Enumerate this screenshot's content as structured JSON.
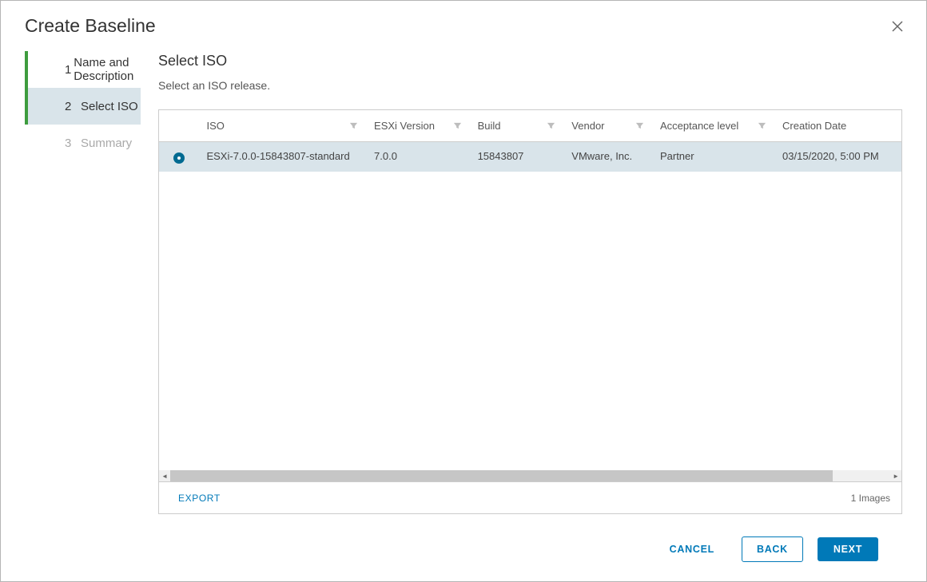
{
  "dialog": {
    "title": "Create Baseline"
  },
  "steps": [
    {
      "num": "1",
      "label": "Name and Description",
      "state": "completed"
    },
    {
      "num": "2",
      "label": "Select ISO",
      "state": "active"
    },
    {
      "num": "3",
      "label": "Summary",
      "state": "pending"
    }
  ],
  "panel": {
    "title": "Select ISO",
    "subtitle": "Select an ISO release."
  },
  "table": {
    "columns": [
      {
        "key": "iso",
        "label": "ISO"
      },
      {
        "key": "ver",
        "label": "ESXi Version"
      },
      {
        "key": "build",
        "label": "Build"
      },
      {
        "key": "vendor",
        "label": "Vendor"
      },
      {
        "key": "accept",
        "label": "Acceptance level"
      },
      {
        "key": "date",
        "label": "Creation Date"
      }
    ],
    "rows": [
      {
        "selected": true,
        "iso": "ESXi-7.0.0-15843807-standard",
        "ver": "7.0.0",
        "build": "15843807",
        "vendor": "VMware, Inc.",
        "accept": "Partner",
        "date": "03/15/2020, 5:00 PM"
      }
    ],
    "export_label": "EXPORT",
    "count_label": "1 Images"
  },
  "footer": {
    "cancel": "CANCEL",
    "back": "BACK",
    "next": "NEXT"
  }
}
